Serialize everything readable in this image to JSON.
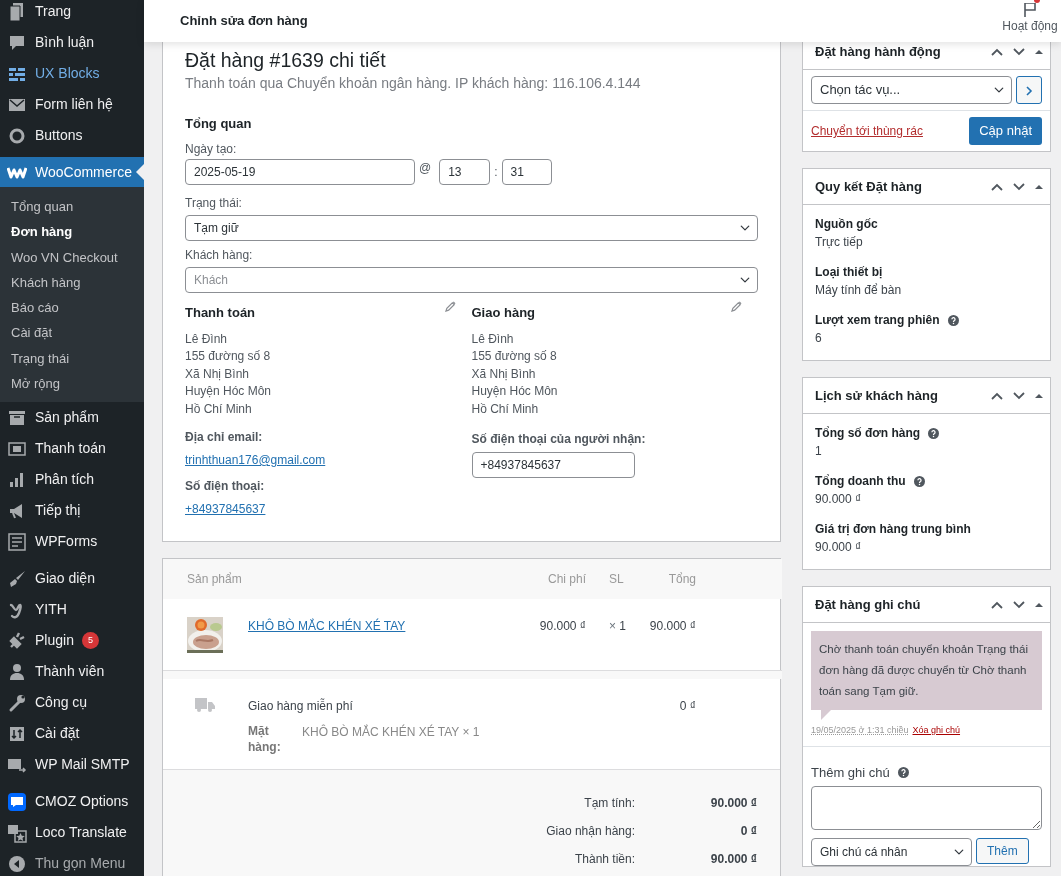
{
  "sidebar": {
    "groups": [
      {
        "items": [
          {
            "label": "Trang",
            "selected": false,
            "hover": false
          },
          {
            "label": "Bình luận",
            "selected": false,
            "hover": false
          },
          {
            "label": "UX Blocks",
            "selected": false,
            "hover": true
          },
          {
            "label": "Form liên hệ",
            "selected": false,
            "hover": false
          },
          {
            "label": "Buttons",
            "selected": false,
            "hover": false
          }
        ]
      },
      {
        "items": [
          {
            "label": "WooCommerce",
            "selected": true,
            "hover": false,
            "submenu": [
              {
                "label": "Tổng quan",
                "selected": false
              },
              {
                "label": "Đơn hàng",
                "selected": true
              },
              {
                "label": "Woo VN Checkout",
                "selected": false
              },
              {
                "label": "Khách hàng",
                "selected": false
              },
              {
                "label": "Báo cáo",
                "selected": false
              },
              {
                "label": "Cài đặt",
                "selected": false
              },
              {
                "label": "Trạng thái",
                "selected": false
              },
              {
                "label": "Mở rộng",
                "selected": false
              }
            ]
          },
          {
            "label": "Sản phẩm",
            "selected": false,
            "hover": false
          },
          {
            "label": "Thanh toán",
            "selected": false,
            "hover": false
          },
          {
            "label": "Phân tích",
            "selected": false,
            "hover": false
          },
          {
            "label": "Tiếp thị",
            "selected": false,
            "hover": false
          },
          {
            "label": "WPForms",
            "selected": false,
            "hover": false
          }
        ]
      },
      {
        "items": [
          {
            "label": "Giao diện",
            "selected": false,
            "hover": false
          },
          {
            "label": "YITH",
            "selected": false,
            "hover": false
          },
          {
            "label": "Plugin",
            "selected": false,
            "hover": false,
            "badge": "5"
          },
          {
            "label": "Thành viên",
            "selected": false,
            "hover": false
          },
          {
            "label": "Công cụ",
            "selected": false,
            "hover": false
          },
          {
            "label": "Cài đặt",
            "selected": false,
            "hover": false
          },
          {
            "label": "WP Mail SMTP",
            "selected": false,
            "hover": false
          }
        ]
      },
      {
        "items": [
          {
            "label": "CMOZ Options",
            "selected": false,
            "hover": false
          },
          {
            "label": "Loco Translate",
            "selected": false,
            "hover": false
          }
        ]
      }
    ],
    "collapse_button": {
      "label": "Thu gọn Menu"
    }
  },
  "header": {
    "title": "Chỉnh sửa đơn hàng",
    "activity": {
      "label": "Hoạt động",
      "has_notification": true
    }
  },
  "order": {
    "title": "Đặt hàng #1639 chi tiết",
    "subtitle": "Thanh toán qua Chuyển khoản ngân hàng. IP khách hàng: 116.106.4.144",
    "general": {
      "heading": "Tổng quan",
      "date_label": "Ngày tạo:",
      "date": "2025-05-19",
      "at": "@",
      "hour": "13",
      "colon": ":",
      "minute": "31",
      "status_label": "Trạng thái:",
      "status": "Tạm giữ",
      "customer_label": "Khách hàng:",
      "customer_placeholder": "Khách"
    },
    "billing": {
      "heading": "Thanh toán",
      "address": [
        "Lê Đình",
        "155 đường số 8",
        "Xã Nhị Bình",
        "Huyện Hóc Môn",
        "Hồ Chí Minh"
      ],
      "email_label": "Địa chỉ email:",
      "email": "trinhthuan176@gmail.com",
      "phone_label": "Số điện thoại:",
      "phone": "+84937845637"
    },
    "shipping": {
      "heading": "Giao hàng",
      "address": [
        "Lê Đình",
        "155 đường số 8",
        "Xã Nhị Bình",
        "Huyện Hóc Môn",
        "Hồ Chí Minh"
      ],
      "phone_label": "Số điện thoại của người nhận:",
      "phone": "+84937845637"
    }
  },
  "items": {
    "columns": [
      "Sản phẩm",
      "Chi phí",
      "SL",
      "Tổng"
    ],
    "rows": [
      {
        "name": "KHÔ BÒ MẮC KHÉN XÉ TAY",
        "cost": "90.000 ₫",
        "qty_sign": "×",
        "qty": "1",
        "total": "90.000 ₫"
      }
    ],
    "shipping": {
      "name": "Giao hàng miễn phí",
      "total": "0 ₫",
      "meta_label": "Mặt hàng:",
      "meta_value": "KHÔ BÒ MẮC KHÉN XÉ TAY × 1"
    },
    "totals": [
      {
        "label": "Tạm tính:",
        "value": "90.000 ₫"
      },
      {
        "label": "Giao nhận hàng:",
        "value": "0 ₫"
      },
      {
        "label": "Thành tiền:",
        "value": "90.000 ₫"
      }
    ]
  },
  "actions": {
    "title": "Đặt hàng hành động",
    "select": "Chọn tác vụ...",
    "trash": "Chuyển tới thùng rác",
    "update": "Cập nhật"
  },
  "attribution": {
    "title": "Quy kết Đặt hàng",
    "fields": [
      {
        "label": "Nguồn gốc",
        "value": "Trực tiếp",
        "help": false
      },
      {
        "label": "Loại thiết bị",
        "value": "Máy tính để bàn",
        "help": false
      },
      {
        "label": "Lượt xem trang phiên",
        "value": "6",
        "help": true
      }
    ]
  },
  "history": {
    "title": "Lịch sử khách hàng",
    "fields": [
      {
        "label": "Tổng số đơn hàng",
        "value": "1",
        "help": true
      },
      {
        "label": "Tổng doanh thu",
        "value": "90.000 ₫",
        "help": true
      },
      {
        "label": "Giá trị đơn hàng trung bình",
        "value": "90.000 ₫",
        "help": false
      }
    ]
  },
  "notes": {
    "title": "Đặt hàng ghi chú",
    "items": [
      {
        "text": "Chờ thanh toán chuyển khoản Trạng thái đơn hàng đã được chuyển từ Chờ thanh toán sang Tạm giữ.",
        "date": "19/05/2025 ở 1:31 chiều",
        "delete": "Xóa ghi chú"
      }
    ],
    "add_label": "Thêm ghi chú",
    "note_type": "Ghi chú cá nhân",
    "add_button": "Thêm"
  }
}
